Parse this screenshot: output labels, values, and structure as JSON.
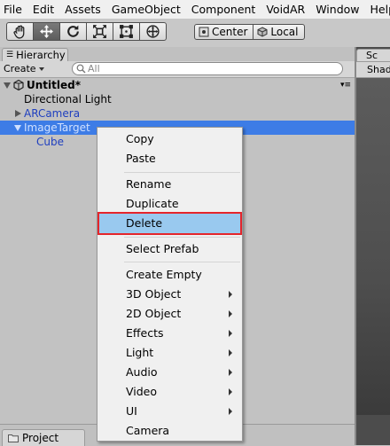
{
  "menubar": [
    "File",
    "Edit",
    "Assets",
    "GameObject",
    "Component",
    "VoidAR",
    "Window",
    "Help"
  ],
  "toolbar": {
    "tools": [
      {
        "icon": "hand-icon",
        "active": false
      },
      {
        "icon": "move-icon",
        "active": true
      },
      {
        "icon": "rotate-icon",
        "active": false
      },
      {
        "icon": "scale-icon",
        "active": false
      },
      {
        "icon": "rect-tool-icon",
        "active": false
      },
      {
        "icon": "transform-tool-icon",
        "active": false
      }
    ],
    "pivot_center_label": "Center",
    "pivot_local_label": "Local"
  },
  "hierarchy": {
    "tab_label": "Hierarchy",
    "create_label": "Create",
    "search_placeholder": "All",
    "scene_name": "Untitled*",
    "items": [
      {
        "label": "Directional Light",
        "blue": false,
        "selected": false,
        "expand": "none"
      },
      {
        "label": "ARCamera",
        "blue": true,
        "selected": false,
        "expand": "collapsed"
      },
      {
        "label": "ImageTarget",
        "blue": true,
        "selected": true,
        "expand": "expanded"
      },
      {
        "label": "Cube",
        "blue": true,
        "selected": false,
        "expand": "none"
      }
    ]
  },
  "scene": {
    "tab_label": "Sc",
    "toolbar_label": "Shad"
  },
  "project": {
    "tab_label": "Project"
  },
  "context_menu": {
    "items": [
      {
        "label": "Copy",
        "submenu": false
      },
      {
        "label": "Paste",
        "submenu": false
      },
      {
        "label": "Rename",
        "submenu": false
      },
      {
        "label": "Duplicate",
        "submenu": false
      },
      {
        "label": "Delete",
        "submenu": false,
        "highlighted": true
      },
      {
        "label": "Select Prefab",
        "submenu": false
      },
      {
        "label": "Create Empty",
        "submenu": false
      },
      {
        "label": "3D Object",
        "submenu": true
      },
      {
        "label": "2D Object",
        "submenu": true
      },
      {
        "label": "Effects",
        "submenu": true
      },
      {
        "label": "Light",
        "submenu": true
      },
      {
        "label": "Audio",
        "submenu": true
      },
      {
        "label": "Video",
        "submenu": true
      },
      {
        "label": "UI",
        "submenu": true
      },
      {
        "label": "Camera",
        "submenu": false
      }
    ]
  },
  "colors": {
    "selection": "#3d7ce6",
    "menu_highlight": "#99c9ef",
    "highlight_border": "#e5252b",
    "prefab_blue": "#1f3fbf"
  }
}
